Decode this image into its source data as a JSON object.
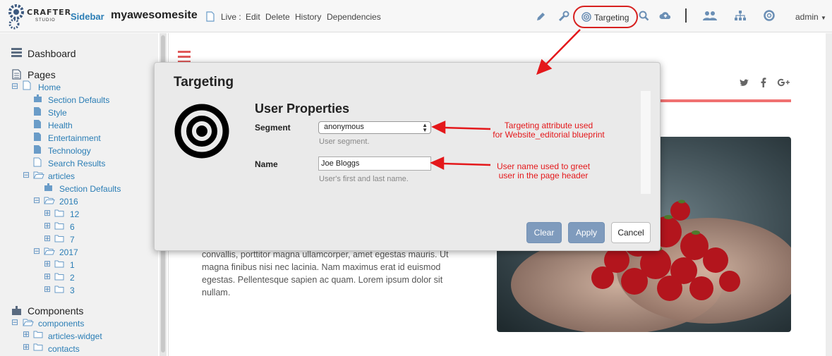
{
  "topbar": {
    "logo_text": "CRAFTER",
    "logo_sub": "STUDIO",
    "sidebar_label": "Sidebar",
    "site_name": "myawesomesite",
    "live_label": "Live :",
    "links": [
      "Edit",
      "Delete",
      "History",
      "Dependencies"
    ],
    "targeting_label": "Targeting",
    "user_label": "admin"
  },
  "sidebar": {
    "dashboard": "Dashboard",
    "pages": "Pages",
    "home": "Home",
    "home_children": [
      "Section Defaults",
      "Style",
      "Health",
      "Entertainment",
      "Technology",
      "Search Results"
    ],
    "articles": "articles",
    "articles_section_defaults": "Section Defaults",
    "year_2016": "2016",
    "months_2016": [
      "12",
      "6",
      "7"
    ],
    "year_2017": "2017",
    "months_2017": [
      "1",
      "2",
      "3"
    ],
    "components": "Components",
    "components_folder": "components",
    "components_children": [
      "articles-widget",
      "contacts"
    ]
  },
  "preview": {
    "lorem": "convallis, porttitor magna ullamcorper, amet egestas mauris. Ut magna finibus nisi nec lacinia. Nam maximus erat id euismod egestas. Pellentesque sapien ac quam. Lorem ipsum dolor sit nullam."
  },
  "modal": {
    "title": "Targeting",
    "heading": "User Properties",
    "segment_label": "Segment",
    "segment_value": "anonymous",
    "segment_help": "User segment.",
    "name_label": "Name",
    "name_value": "Joe Bloggs",
    "name_help": "User's first and last name.",
    "clear_label": "Clear",
    "apply_label": "Apply",
    "cancel_label": "Cancel"
  },
  "annotations": {
    "segment_note_line1": "Targeting attribute used",
    "segment_note_line2": "for Website_editorial blueprint",
    "name_note_line1": "User name used to greet",
    "name_note_line2": "user in the page header"
  },
  "colors": {
    "accent_blue": "#2a7db5",
    "annotation_red": "#e4181b",
    "button_blue": "#7f9bbd",
    "site_red": "#f07171"
  }
}
